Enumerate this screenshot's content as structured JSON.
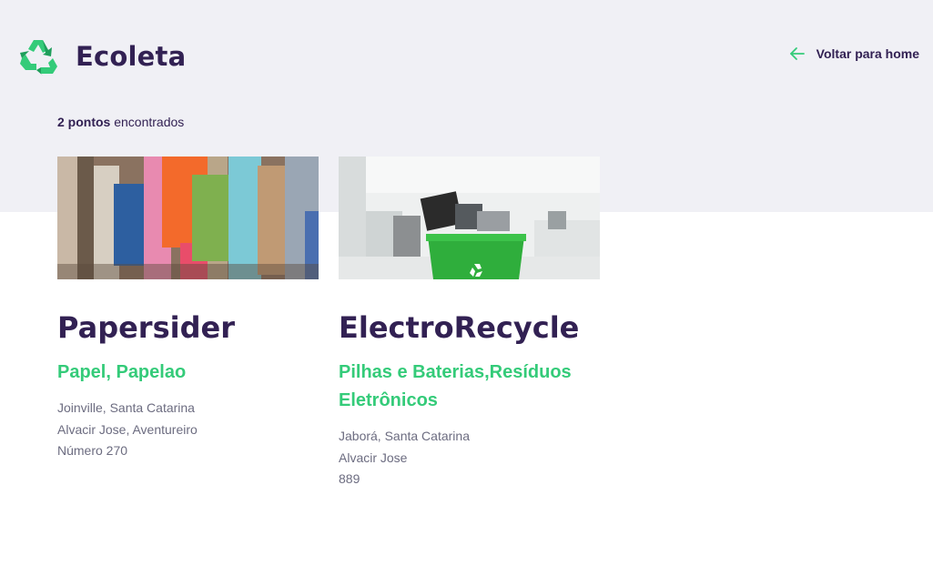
{
  "header": {
    "app_name": "Ecoleta",
    "logo_icon": "recycle-icon",
    "back_label": "Voltar para home",
    "back_icon": "arrow-left-icon"
  },
  "results": {
    "count_bold": "2 pontos",
    "count_rest": " encontrados"
  },
  "colors": {
    "primary": "#34cb79",
    "title": "#322153",
    "text": "#6c6c80",
    "background": "#f0f0f5"
  },
  "points": [
    {
      "name": "Papersider",
      "items": "Papel, Papelao",
      "city_state": "Joinville, Santa Catarina",
      "street": "Alvacir Jose, Aventureiro",
      "number": "Número 270"
    },
    {
      "name": "ElectroRecycle",
      "items": "Pilhas e Baterias,Resíduos Eletrônicos",
      "city_state": "Jaborá, Santa Catarina",
      "street": "Alvacir Jose",
      "number": "889"
    }
  ]
}
